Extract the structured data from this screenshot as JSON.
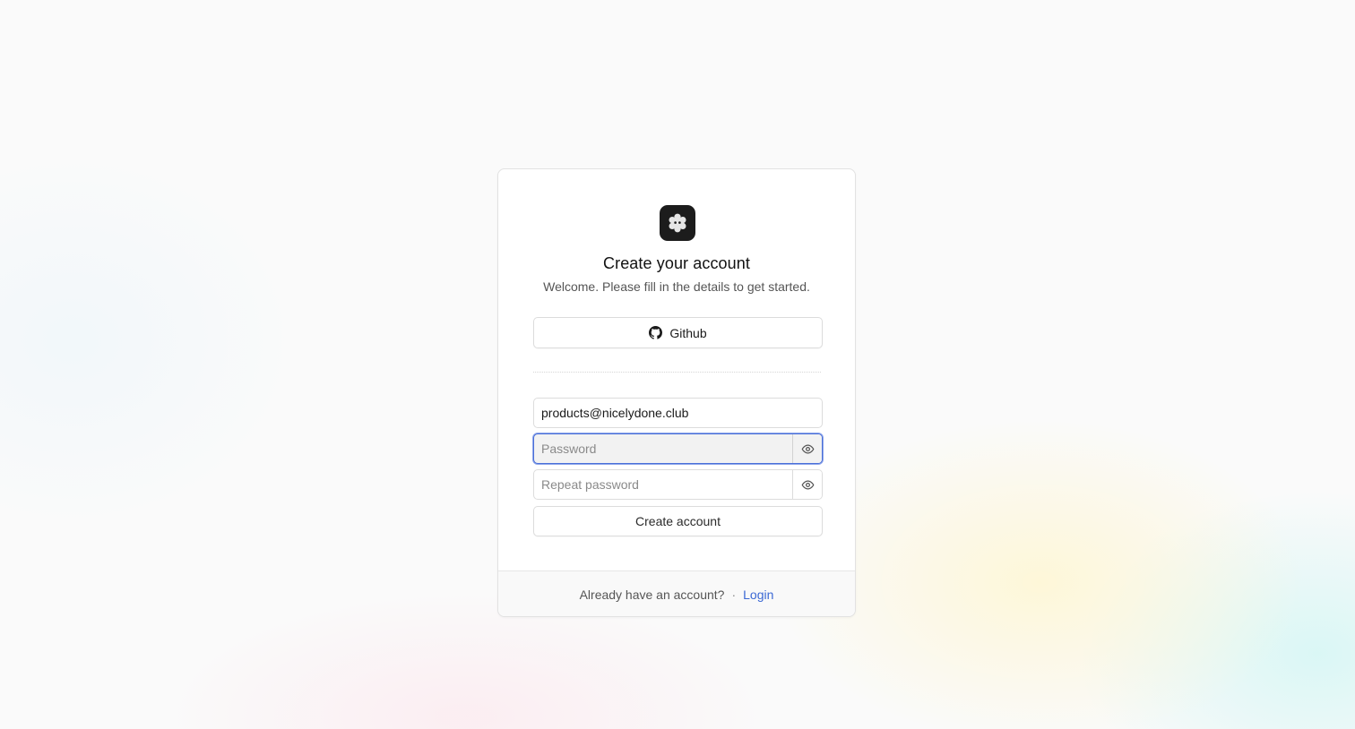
{
  "header": {
    "logo_icon": "flower-icon",
    "title": "Create your account",
    "subtitle": "Welcome. Please fill in the details to get started."
  },
  "social": {
    "github_label": "Github",
    "github_icon": "github-icon"
  },
  "form": {
    "email_value": "products@nicelydone.club",
    "password_placeholder": "Password",
    "repeat_placeholder": "Repeat password",
    "eye_icon": "eye-icon",
    "submit_label": "Create account"
  },
  "footer": {
    "prompt": "Already have an account?",
    "separator": "·",
    "login_label": "Login",
    "link_color": "#3b68d4"
  },
  "colors": {
    "focus_ring": "#4a6fd8",
    "logo_bg": "#1c1c1c"
  }
}
